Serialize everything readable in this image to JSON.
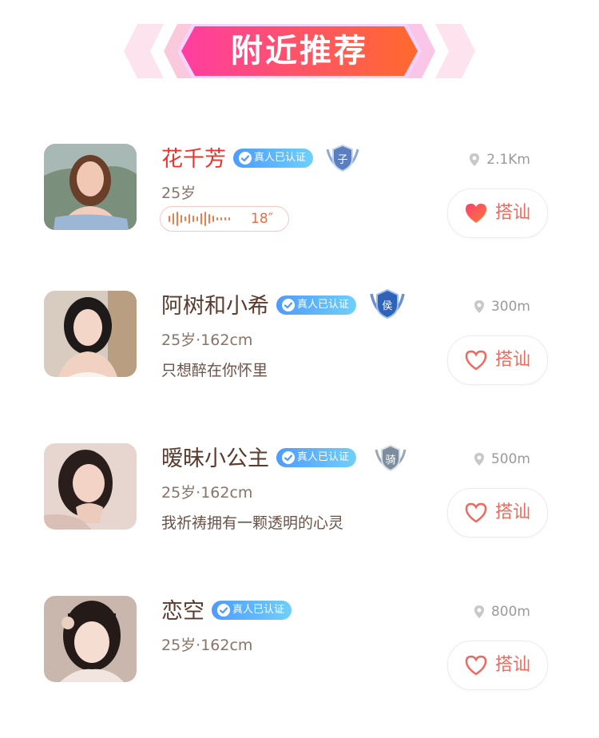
{
  "header": {
    "title": "附近推荐"
  },
  "greet_label": "搭讪",
  "verified_label": "真人已认证",
  "users": [
    {
      "name": "花千芳",
      "age": "25岁",
      "distance": "2.1Km",
      "voice_duration": "18″",
      "rank_char": "子",
      "liked": true
    },
    {
      "name": "阿树和小希",
      "age": "25岁·162cm",
      "bio": "只想醉在你怀里",
      "distance": "300m",
      "rank_char": "侯",
      "liked": false
    },
    {
      "name": "暧昧小公主",
      "age": "25岁·162cm",
      "bio": "我祈祷拥有一颗透明的心灵",
      "distance": "500m",
      "rank_char": "骑",
      "liked": false
    },
    {
      "name": "恋空",
      "age": "25岁·162cm",
      "distance": "800m",
      "liked": false
    }
  ],
  "colors": {
    "accent": "#ef6a5e",
    "name_highlight": "#e8352f",
    "verified_start": "#4e9bff",
    "verified_end": "#6fd0f8"
  }
}
